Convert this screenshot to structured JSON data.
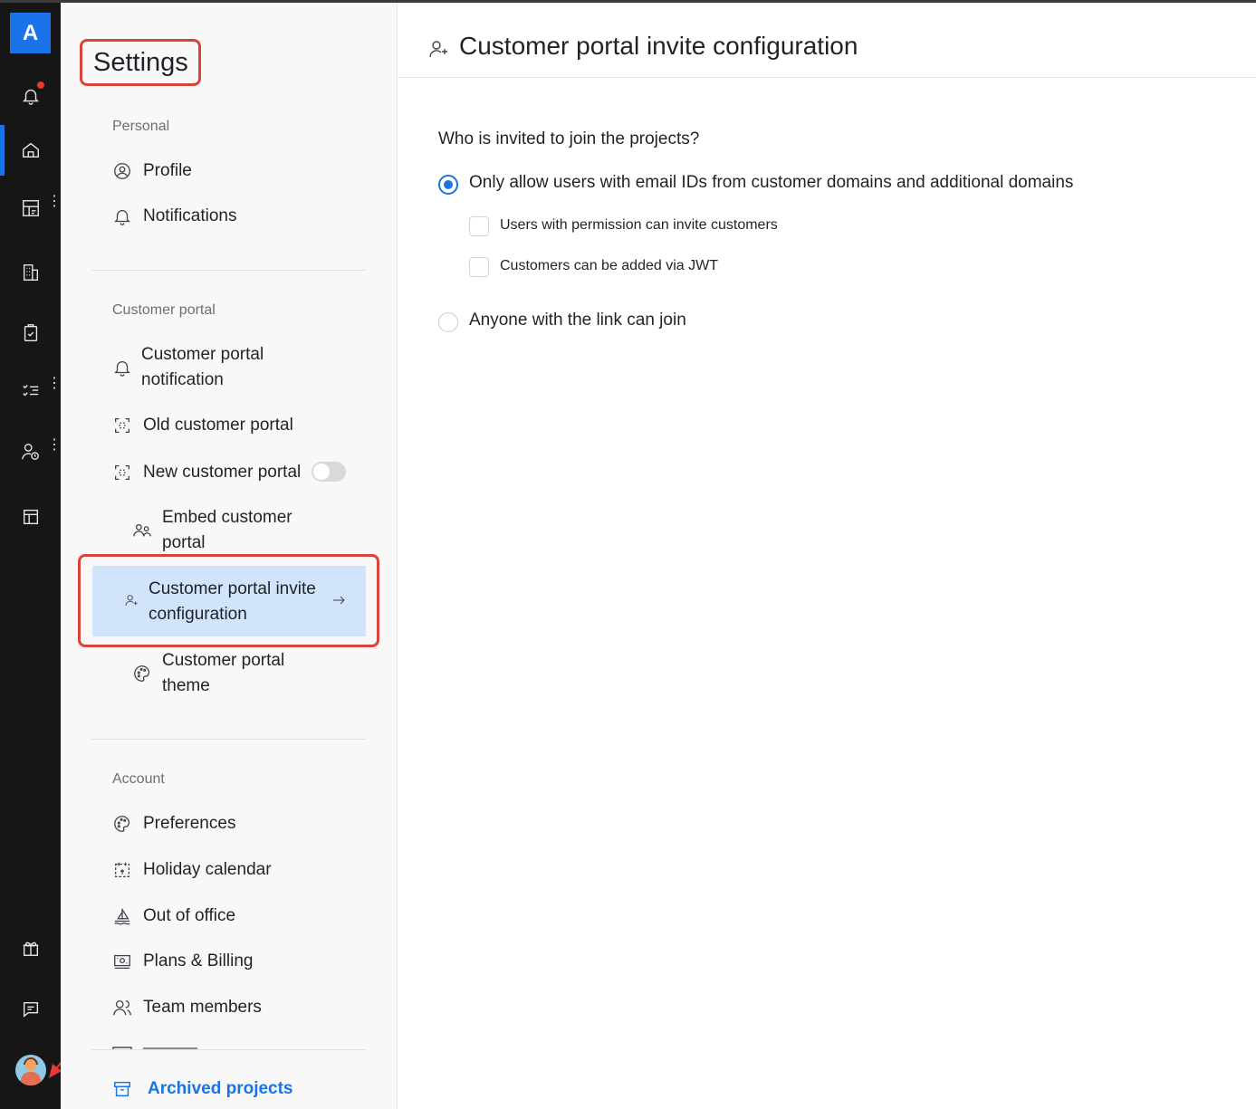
{
  "app": {
    "logo_letter": "A"
  },
  "sidebar": {
    "title": "Settings",
    "sections": {
      "personal": {
        "label": "Personal",
        "items": {
          "profile": "Profile",
          "notifications": "Notifications"
        }
      },
      "customer_portal": {
        "label": "Customer portal",
        "items": {
          "notification": "Customer portal notification",
          "old_portal": "Old customer portal",
          "new_portal": "New customer portal",
          "embed": "Embed customer portal",
          "invite_config": "Customer portal invite configuration",
          "theme": "Customer portal theme"
        },
        "new_portal_toggle_on": false
      },
      "account": {
        "label": "Account",
        "items": {
          "preferences": "Preferences",
          "holiday_calendar": "Holiday calendar",
          "out_of_office": "Out of office",
          "plans_billing": "Plans & Billing",
          "team_members": "Team members"
        }
      }
    },
    "archived_projects": "Archived projects"
  },
  "main": {
    "title": "Customer portal invite configuration",
    "question": "Who is invited to join the projects?",
    "options": {
      "domains": "Only allow users with email IDs from customer domains and additional domains",
      "link": "Anyone with the link can join"
    },
    "selected_option": "domains",
    "checks": {
      "permission": "Users with permission can invite customers",
      "jwt": "Customers can be added via JWT"
    }
  },
  "colors": {
    "accent": "#1a73e8",
    "rail_bg": "#161616",
    "highlight": "#d9443a",
    "active_bg": "#d2e3fc"
  }
}
